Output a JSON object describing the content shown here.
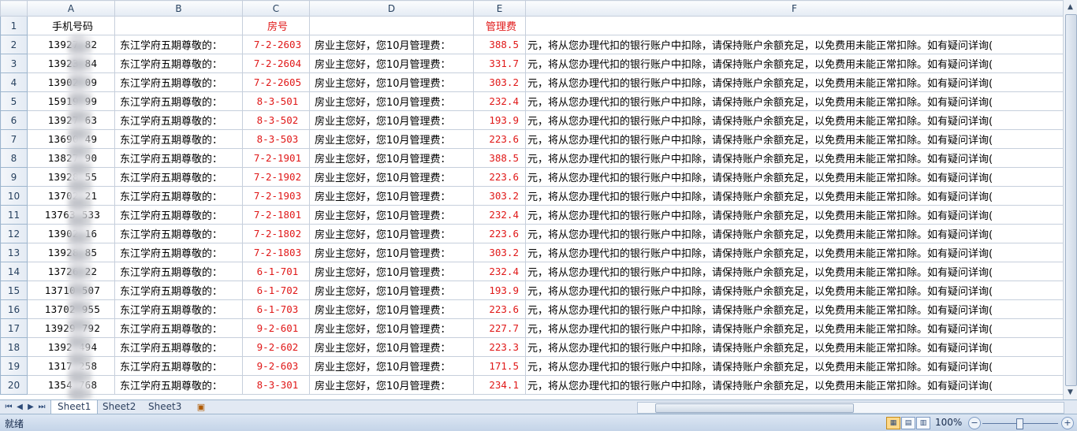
{
  "columns": [
    "A",
    "B",
    "C",
    "D",
    "E",
    "F"
  ],
  "header_row": {
    "row_num": "1",
    "a": "手机号码",
    "b": "",
    "c": "房号",
    "d": "",
    "e": "管理费",
    "f": ""
  },
  "rows": [
    {
      "n": "2",
      "phone": "13927   82",
      "b": "东江学府五期尊敬的：",
      "room": "7-2-2603",
      "d": "房业主您好，您10月管理费：",
      "fee": "388.5",
      "f": "元，将从您办理代扣的银行账户中扣除，请保持账户余额充足，以免费用未能正常扣除。如有疑问详询("
    },
    {
      "n": "3",
      "phone": "13923   84",
      "b": "东江学府五期尊敬的：",
      "room": "7-2-2604",
      "d": "房业主您好，您10月管理费：",
      "fee": "331.7",
      "f": "元，将从您办理代扣的银行账户中扣除，请保持账户余额充足，以免费用未能正常扣除。如有疑问详询("
    },
    {
      "n": "4",
      "phone": "13902   09",
      "b": "东江学府五期尊敬的：",
      "room": "7-2-2605",
      "d": "房业主您好，您10月管理费：",
      "fee": "303.2",
      "f": "元，将从您办理代扣的银行账户中扣除，请保持账户余额充足，以免费用未能正常扣除。如有疑问详询("
    },
    {
      "n": "5",
      "phone": "15919   99",
      "b": "东江学府五期尊敬的：",
      "room": "8-3-501",
      "d": "房业主您好，您10月管理费：",
      "fee": "232.4",
      "f": "元，将从您办理代扣的银行账户中扣除，请保持账户余额充足，以免费用未能正常扣除。如有疑问详询("
    },
    {
      "n": "6",
      "phone": "13927   63",
      "b": "东江学府五期尊敬的：",
      "room": "8-3-502",
      "d": "房业主您好，您10月管理费：",
      "fee": "193.9",
      "f": "元，将从您办理代扣的银行账户中扣除，请保持账户余额充足，以免费用未能正常扣除。如有疑问详询("
    },
    {
      "n": "7",
      "phone": "13690   49",
      "b": "东江学府五期尊敬的：",
      "room": "8-3-503",
      "d": "房业主您好，您10月管理费：",
      "fee": "223.6",
      "f": "元，将从您办理代扣的银行账户中扣除，请保持账户余额充足，以免费用未能正常扣除。如有疑问详询("
    },
    {
      "n": "8",
      "phone": "13827   90",
      "b": "东江学府五期尊敬的：",
      "room": "7-2-1901",
      "d": "房业主您好，您10月管理费：",
      "fee": "388.5",
      "f": "元，将从您办理代扣的银行账户中扣除，请保持账户余额充足，以免费用未能正常扣除。如有疑问详询("
    },
    {
      "n": "9",
      "phone": "13928   55",
      "b": "东江学府五期尊敬的：",
      "room": "7-2-1902",
      "d": "房业主您好，您10月管理费：",
      "fee": "223.6",
      "f": "元，将从您办理代扣的银行账户中扣除，请保持账户余额充足，以免费用未能正常扣除。如有疑问详询("
    },
    {
      "n": "10",
      "phone": "13702   21",
      "b": "东江学府五期尊敬的：",
      "room": "7-2-1903",
      "d": "房业主您好，您10月管理费：",
      "fee": "303.2",
      "f": "元，将从您办理代扣的银行账户中扣除，请保持账户余额充足，以免费用未能正常扣除。如有疑问详询("
    },
    {
      "n": "11",
      "phone": "13763   533",
      "b": "东江学府五期尊敬的：",
      "room": "7-2-1801",
      "d": "房业主您好，您10月管理费：",
      "fee": "232.4",
      "f": "元，将从您办理代扣的银行账户中扣除，请保持账户余额充足，以免费用未能正常扣除。如有疑问详询("
    },
    {
      "n": "12",
      "phone": "13902   16",
      "b": "东江学府五期尊敬的：",
      "room": "7-2-1802",
      "d": "房业主您好，您10月管理费：",
      "fee": "223.6",
      "f": "元，将从您办理代扣的银行账户中扣除，请保持账户余额充足，以免费用未能正常扣除。如有疑问详询("
    },
    {
      "n": "13",
      "phone": "13928   85",
      "b": "东江学府五期尊敬的：",
      "room": "7-2-1803",
      "d": "房业主您好，您10月管理费：",
      "fee": "303.2",
      "f": "元，将从您办理代扣的银行账户中扣除，请保持账户余额充足，以免费用未能正常扣除。如有疑问详询("
    },
    {
      "n": "14",
      "phone": "13726   22",
      "b": "东江学府五期尊敬的：",
      "room": "6-1-701",
      "d": "房业主您好，您10月管理费：",
      "fee": "232.4",
      "f": "元，将从您办理代扣的银行账户中扣除，请保持账户余额充足，以免费用未能正常扣除。如有疑问详询("
    },
    {
      "n": "15",
      "phone": "13710   507",
      "b": "东江学府五期尊敬的：",
      "room": "6-1-702",
      "d": "房业主您好，您10月管理费：",
      "fee": "193.9",
      "f": "元，将从您办理代扣的银行账户中扣除，请保持账户余额充足，以免费用未能正常扣除。如有疑问详询("
    },
    {
      "n": "16",
      "phone": "13702   955",
      "b": "东江学府五期尊敬的：",
      "room": "6-1-703",
      "d": "房业主您好，您10月管理费：",
      "fee": "223.6",
      "f": "元，将从您办理代扣的银行账户中扣除，请保持账户余额充足，以免费用未能正常扣除。如有疑问详询("
    },
    {
      "n": "17",
      "phone": "13929   792",
      "b": "东江学府五期尊敬的：",
      "room": "9-2-601",
      "d": "房业主您好，您10月管理费：",
      "fee": "227.7",
      "f": "元，将从您办理代扣的银行账户中扣除，请保持账户余额充足，以免费用未能正常扣除。如有疑问详询("
    },
    {
      "n": "18",
      "phone": "1392   494",
      "b": "东江学府五期尊敬的：",
      "room": "9-2-602",
      "d": "房业主您好，您10月管理费：",
      "fee": "223.3",
      "f": "元，将从您办理代扣的银行账户中扣除，请保持账户余额充足，以免费用未能正常扣除。如有疑问详询("
    },
    {
      "n": "19",
      "phone": "1317   258",
      "b": "东江学府五期尊敬的：",
      "room": "9-2-603",
      "d": "房业主您好，您10月管理费：",
      "fee": "171.5",
      "f": "元，将从您办理代扣的银行账户中扣除，请保持账户余额充足，以免费用未能正常扣除。如有疑问详询("
    },
    {
      "n": "20",
      "phone": "1354   768",
      "b": "东江学府五期尊敬的：",
      "room": "8-3-301",
      "d": "房业主您好，您10月管理费：",
      "fee": "234.1",
      "f": "元，将从您办理代扣的银行账户中扣除，请保持账户余额充足，以免费用未能正常扣除。如有疑问详询("
    }
  ],
  "sheets": {
    "tabs": [
      "Sheet1",
      "Sheet2",
      "Sheet3"
    ],
    "active": "Sheet1",
    "nav_icons": [
      "first-sheet-icon",
      "prev-sheet-icon",
      "next-sheet-icon",
      "last-sheet-icon"
    ],
    "new_sheet_icon": "insert-sheet-icon"
  },
  "status": {
    "text": "就绪",
    "zoom": "100%",
    "zoom_minus": "−",
    "zoom_plus": "+",
    "zoom_level": 1.0
  },
  "colors": {
    "red_text": "#e01818",
    "header_bg": "#e4ebf4",
    "grid_line": "#c6cfdc"
  }
}
